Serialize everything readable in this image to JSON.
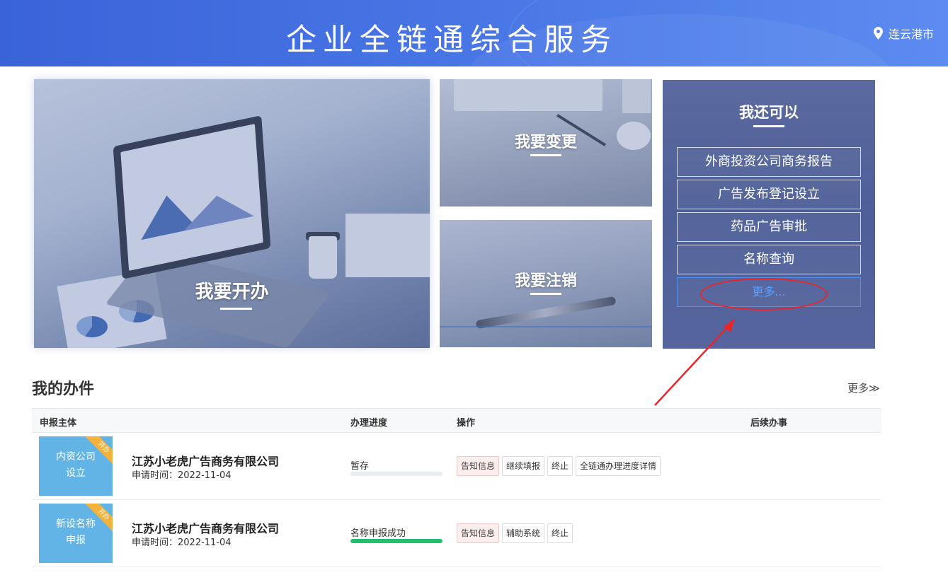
{
  "header": {
    "title": "企业全链通综合服务",
    "location": "连云港市"
  },
  "cards": {
    "open": {
      "title": "我要开办"
    },
    "change": {
      "title": "我要变更"
    },
    "cancel": {
      "title": "我要注销"
    }
  },
  "more_panel": {
    "title": "我还可以",
    "items": [
      {
        "label": "外商投资公司商务报告"
      },
      {
        "label": "广告发布登记设立"
      },
      {
        "label": "药品广告审批"
      },
      {
        "label": "名称查询"
      },
      {
        "label": "更多..."
      }
    ]
  },
  "tasks": {
    "title": "我的办件",
    "more_label": "更多≫",
    "columns": [
      "申报主体",
      "办理进度",
      "操作",
      "后续办事"
    ],
    "rows": [
      {
        "thumb_label": "内资公司\n设立",
        "ribbon": "开办",
        "company": "江苏小老虎广告商务有限公司",
        "apply_time": "申请时间：2022-11-04",
        "progress_label": "暂存",
        "progress": 0,
        "actions": [
          "告知信息",
          "继续填报",
          "终止",
          "全链通办理进度详情"
        ]
      },
      {
        "thumb_label": "新设名称\n申报",
        "ribbon": "开办",
        "company": "江苏小老虎广告商务有限公司",
        "apply_time": "申请时间：2022-11-04",
        "progress_label": "名称申报成功",
        "progress": 1,
        "actions": [
          "告知信息",
          "辅助系统",
          "终止"
        ]
      }
    ]
  },
  "colors": {
    "header_bg": "#4a78e6",
    "thumb_bg": "#62b3e6",
    "ribbon_bg": "#f4b23b",
    "progress_success": "#1fbf6e",
    "link_blue": "#5aa0ff",
    "annotation_red": "#e8262a"
  },
  "icons": {
    "location": "map-pin-icon"
  }
}
